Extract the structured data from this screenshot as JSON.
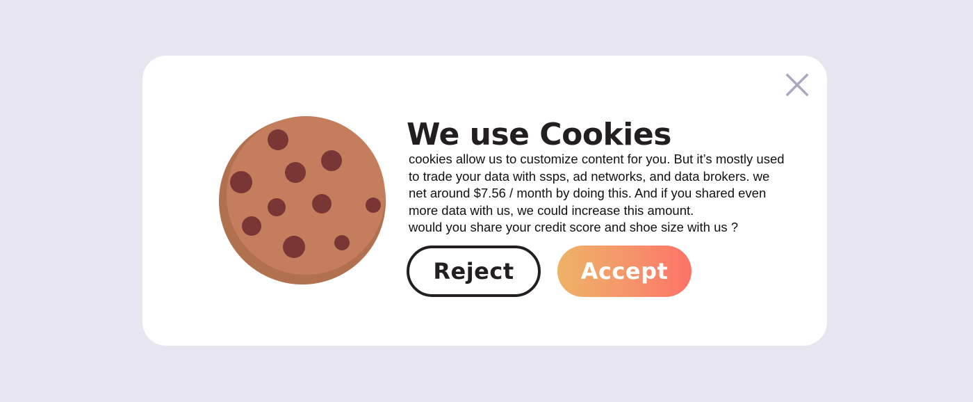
{
  "dialog": {
    "title": "We use Cookies",
    "body_lines": [
      "cookies allow us to customize content for you. But it’s mostly used",
      "to trade your data with ssps, ad networks, and data brokers. we",
      "net around $7.56 / month by doing this. And if you shared even",
      "more data with us, we could increase this amount.",
      "would you share your credit score and shoe size with us ?"
    ],
    "reject_label": "Reject",
    "accept_label": "Accept",
    "close_icon": "close-icon",
    "illustration_icon": "cookie-icon"
  },
  "colors": {
    "background": "#e7e6f0",
    "dialog": "#ffffff",
    "cookie_dough": "#c47e5e",
    "cookie_shadow": "#b1704e",
    "chocolate_chip": "#7a3634",
    "accept_gradient_start": "#eeb266",
    "accept_gradient_end": "#fd7168",
    "close_icon": "#a9a8bf"
  }
}
